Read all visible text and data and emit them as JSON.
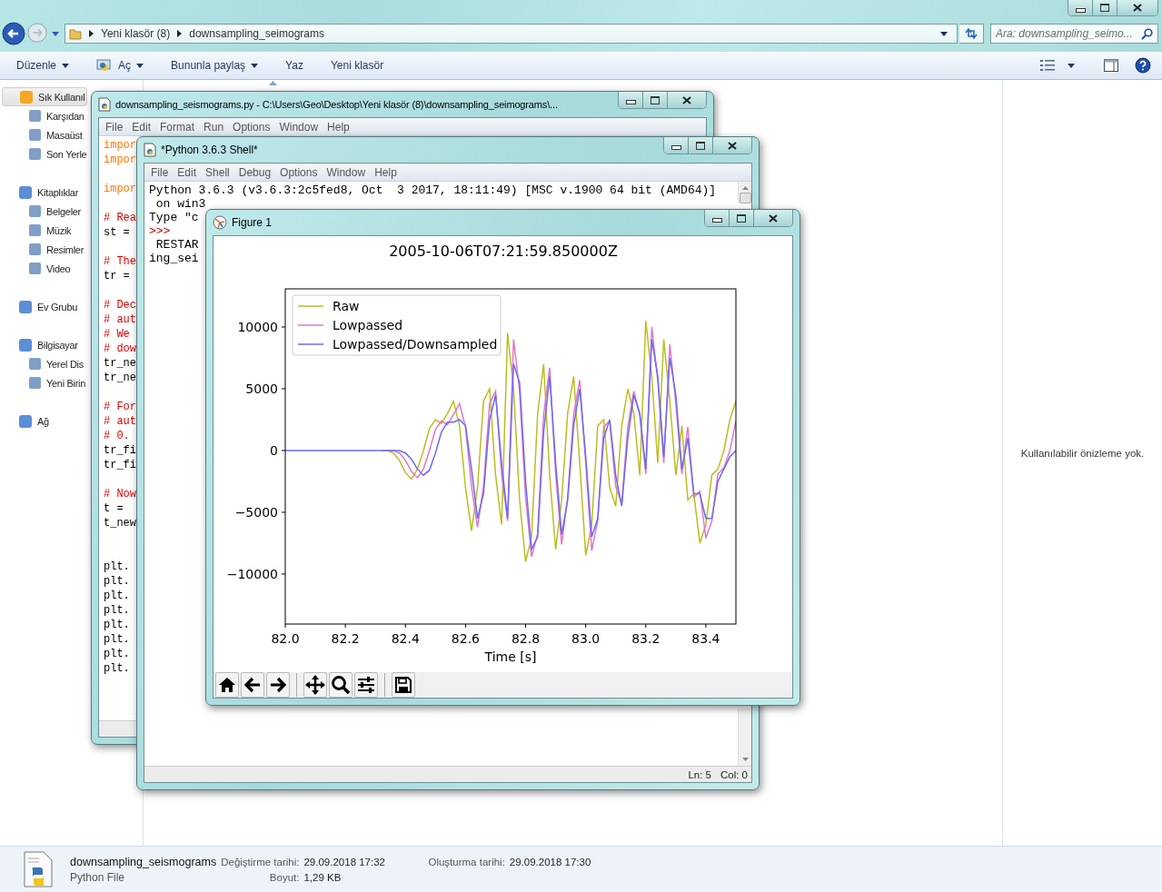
{
  "explorer": {
    "breadcrumbs": [
      "Yeni klasör (8)",
      "downsampling_seimograms"
    ],
    "search": {
      "placeholder": "Ara: downsampling_seimo..."
    },
    "toolbar": [
      {
        "label": "Düzenle",
        "dropdown": true
      },
      {
        "label": "Aç",
        "dropdown": true
      },
      {
        "label": "Bununla paylaş",
        "dropdown": true
      },
      {
        "label": "Yaz",
        "dropdown": false
      },
      {
        "label": "Yeni klasör",
        "dropdown": false
      }
    ],
    "nav": [
      {
        "label": "Sık Kullanıl",
        "selected": true,
        "children": [
          {
            "label": "Karşıdan",
            "selected": false
          },
          {
            "label": "Masaüst",
            "selected": false
          },
          {
            "label": "Son Yerle",
            "selected": false
          }
        ]
      },
      {
        "label": "Kitaplıklar",
        "selected": false,
        "children": [
          {
            "label": "Belgeler",
            "selected": false
          },
          {
            "label": "Müzik",
            "selected": false
          },
          {
            "label": "Resimler",
            "selected": false
          },
          {
            "label": "Video",
            "selected": false
          }
        ]
      },
      {
        "label": "Ev Grubu",
        "selected": false
      },
      {
        "label": "Bilgisayar",
        "selected": false,
        "children": [
          {
            "label": "Yerel Dis",
            "selected": false
          },
          {
            "label": "Yeni Birin",
            "selected": false
          }
        ]
      },
      {
        "label": "Ağ",
        "selected": false
      }
    ],
    "preview_message": "Kullanılabilir önizleme yok.",
    "details": {
      "name": "downsampling_seismograms",
      "type": "Python File",
      "fields": [
        {
          "label": "Değiştirme tarihi:",
          "value": "29.09.2018 17:32"
        },
        {
          "label": "Boyut:",
          "value": "1,29 KB"
        },
        {
          "label": "Oluşturma tarihi:",
          "value": "29.09.2018 17:30"
        }
      ]
    }
  },
  "editor_window": {
    "title": "downsampling_seismograms.py - C:\\Users\\Geo\\Desktop\\Yeni klasör (8)\\downsampling_seimograms\\...",
    "menu": [
      "File",
      "Edit",
      "Format",
      "Run",
      "Options",
      "Window",
      "Help"
    ],
    "code_lines": [
      {
        "kind": "keyword",
        "text": "impor"
      },
      {
        "kind": "keyword",
        "text": "impor"
      },
      {
        "kind": "blank"
      },
      {
        "kind": "keyword",
        "text": "impor"
      },
      {
        "kind": "blank"
      },
      {
        "kind": "comment",
        "text": "# Rea"
      },
      {
        "kind": "code",
        "text": "st ="
      },
      {
        "kind": "blank"
      },
      {
        "kind": "comment",
        "text": "# The"
      },
      {
        "kind": "code",
        "text": "tr ="
      },
      {
        "kind": "blank"
      },
      {
        "kind": "comment",
        "text": "# Dec"
      },
      {
        "kind": "comment",
        "text": "# aut"
      },
      {
        "kind": "comment",
        "text": "# We"
      },
      {
        "kind": "comment",
        "text": "# dow"
      },
      {
        "kind": "code",
        "text": "tr_ne"
      },
      {
        "kind": "code",
        "text": "tr_ne"
      },
      {
        "kind": "blank"
      },
      {
        "kind": "comment",
        "text": "# For"
      },
      {
        "kind": "comment",
        "text": "# aut"
      },
      {
        "kind": "comment",
        "text": "# 0."
      },
      {
        "kind": "code",
        "text": "tr_fi"
      },
      {
        "kind": "code",
        "text": "tr_fi"
      },
      {
        "kind": "blank"
      },
      {
        "kind": "comment",
        "text": "# Now"
      },
      {
        "kind": "code",
        "text": "t ="
      },
      {
        "kind": "code",
        "text": "t_new"
      },
      {
        "kind": "blank"
      },
      {
        "kind": "blank"
      },
      {
        "kind": "code",
        "text": "plt."
      },
      {
        "kind": "code",
        "text": "plt."
      },
      {
        "kind": "code",
        "text": "plt."
      },
      {
        "kind": "code",
        "text": "plt."
      },
      {
        "kind": "code",
        "text": "plt."
      },
      {
        "kind": "code",
        "text": "plt."
      },
      {
        "kind": "code",
        "text": "plt."
      },
      {
        "kind": "code",
        "text": "plt."
      }
    ]
  },
  "shell_window": {
    "title": "*Python 3.6.3 Shell*",
    "menu": [
      "File",
      "Edit",
      "Shell",
      "Debug",
      "Options",
      "Window",
      "Help"
    ],
    "lines": [
      {
        "kind": "output",
        "text": "Python 3.6.3 (v3.6.3:2c5fed8, Oct  3 2017, 18:11:49) [MSC v.1900 64 bit (AMD64)]"
      },
      {
        "kind": "output",
        "text": " on win3"
      },
      {
        "kind": "output",
        "text": "Type \"c"
      },
      {
        "kind": "prompt",
        "text": ">>>"
      },
      {
        "kind": "output",
        "text": " RESTAR"
      },
      {
        "kind": "output",
        "text": "ing_sei"
      }
    ],
    "status": [
      "Ln: 5",
      "Col: 0"
    ]
  },
  "figure_window": {
    "title": "Figure 1",
    "chart_data": {
      "type": "line",
      "title": "2005-10-06T07:21:59.850000Z",
      "xlabel": "Time [s]",
      "x": [
        82.0,
        82.02,
        82.04,
        82.06,
        82.08,
        82.1,
        82.12,
        82.14,
        82.16,
        82.18,
        82.2,
        82.22,
        82.24,
        82.26,
        82.28,
        82.3,
        82.32,
        82.34,
        82.36,
        82.38,
        82.4,
        82.42,
        82.44,
        82.46,
        82.48,
        82.5,
        82.52,
        82.54,
        82.56,
        82.58,
        82.6,
        82.62,
        82.64,
        82.66,
        82.68,
        82.7,
        82.72,
        82.74,
        82.76,
        82.78,
        82.8,
        82.82,
        82.84,
        82.86,
        82.88,
        82.9,
        82.92,
        82.94,
        82.96,
        82.98,
        83.0,
        83.02,
        83.04,
        83.06,
        83.08,
        83.1,
        83.12,
        83.14,
        83.16,
        83.18,
        83.2,
        83.22,
        83.24,
        83.26,
        83.28,
        83.3,
        83.32,
        83.34,
        83.36,
        83.38,
        83.4,
        83.42,
        83.44,
        83.46,
        83.48,
        83.5
      ],
      "series": [
        {
          "name": "Raw",
          "color": "#bcbd22",
          "values": [
            null,
            null,
            null,
            null,
            null,
            null,
            null,
            null,
            null,
            null,
            null,
            null,
            null,
            null,
            null,
            null,
            0,
            0,
            -200,
            -800,
            -1800,
            -2300,
            -1500,
            0,
            1800,
            2500,
            2200,
            3000,
            4000,
            2000,
            -3000,
            -6500,
            -3000,
            4000,
            5000,
            -2000,
            -6000,
            9500,
            5000,
            -4000,
            -9000,
            -7000,
            3000,
            7000,
            -2000,
            -8000,
            -4000,
            3000,
            6000,
            -1000,
            -8500,
            -6000,
            2000,
            2500,
            -3000,
            -4500,
            2000,
            5000,
            3000,
            -2000,
            10500,
            6000,
            -1000,
            9000,
            4000,
            -2000,
            2000,
            -4000,
            -3500,
            -7500,
            -6000,
            -2000,
            -1500,
            0,
            2500,
            4000
          ]
        },
        {
          "name": "Lowpassed",
          "color": "#e377c2",
          "values": [
            null,
            null,
            null,
            null,
            null,
            null,
            null,
            null,
            null,
            null,
            null,
            null,
            null,
            null,
            null,
            null,
            null,
            0,
            0,
            -200,
            -800,
            -1700,
            -2200,
            -1500,
            0,
            1700,
            2400,
            2100,
            2900,
            3800,
            1900,
            -2900,
            -6200,
            -2900,
            3800,
            4800,
            -1900,
            -5700,
            9000,
            4800,
            -3800,
            -8600,
            -6700,
            2900,
            6700,
            -1900,
            -7600,
            -3800,
            2900,
            5700,
            -1000,
            -8100,
            -5700,
            1900,
            2400,
            -2900,
            -4300,
            1900,
            4800,
            2900,
            -1900,
            10000,
            5700,
            -1000,
            8600,
            3800,
            -1900,
            1900,
            -3800,
            -3300,
            -7100,
            -5700,
            -1900,
            -1400,
            0,
            2400
          ]
        },
        {
          "name": "Lowpassed/Downsampled",
          "color": "#6b6bf5",
          "values": [
            0,
            0,
            0,
            0,
            0,
            0,
            0,
            0,
            0,
            0,
            0,
            0,
            0,
            0,
            0,
            0,
            0,
            0,
            0,
            0,
            -200,
            -700,
            -1500,
            -2000,
            -1600,
            -200,
            1500,
            2300,
            2300,
            2500,
            2000,
            -1500,
            -5500,
            -3500,
            2500,
            4500,
            -1000,
            -5500,
            7000,
            5500,
            -2500,
            -8000,
            -7000,
            1500,
            6000,
            -1000,
            -6800,
            -4000,
            2000,
            5000,
            -500,
            -7000,
            -5500,
            1000,
            2500,
            -2000,
            -4500,
            1000,
            4500,
            3000,
            -1500,
            9000,
            6000,
            -500,
            7500,
            4500,
            -1500,
            1000,
            -3500,
            -3500,
            -5500,
            -5500,
            -2500,
            -1500,
            -500,
            0
          ]
        }
      ],
      "legend": true,
      "xlim": [
        82.0,
        83.5
      ],
      "ylim": [
        -14050,
        13090
      ],
      "xticks": [
        {
          "value": 82.0,
          "label": "82.0"
        },
        {
          "value": 82.2,
          "label": "82.2"
        },
        {
          "value": 82.4,
          "label": "82.4"
        },
        {
          "value": 82.6,
          "label": "82.6"
        },
        {
          "value": 82.8,
          "label": "82.8"
        },
        {
          "value": 83.0,
          "label": "83.0"
        },
        {
          "value": 83.2,
          "label": "83.2"
        },
        {
          "value": 83.4,
          "label": "83.4"
        }
      ],
      "yticks": [
        {
          "value": 10000,
          "label": "10000"
        },
        {
          "value": 5000,
          "label": "5000"
        },
        {
          "value": 0,
          "label": "0"
        },
        {
          "value": -5000,
          "label": "−5000"
        },
        {
          "value": -10000,
          "label": "−10000"
        }
      ]
    }
  }
}
